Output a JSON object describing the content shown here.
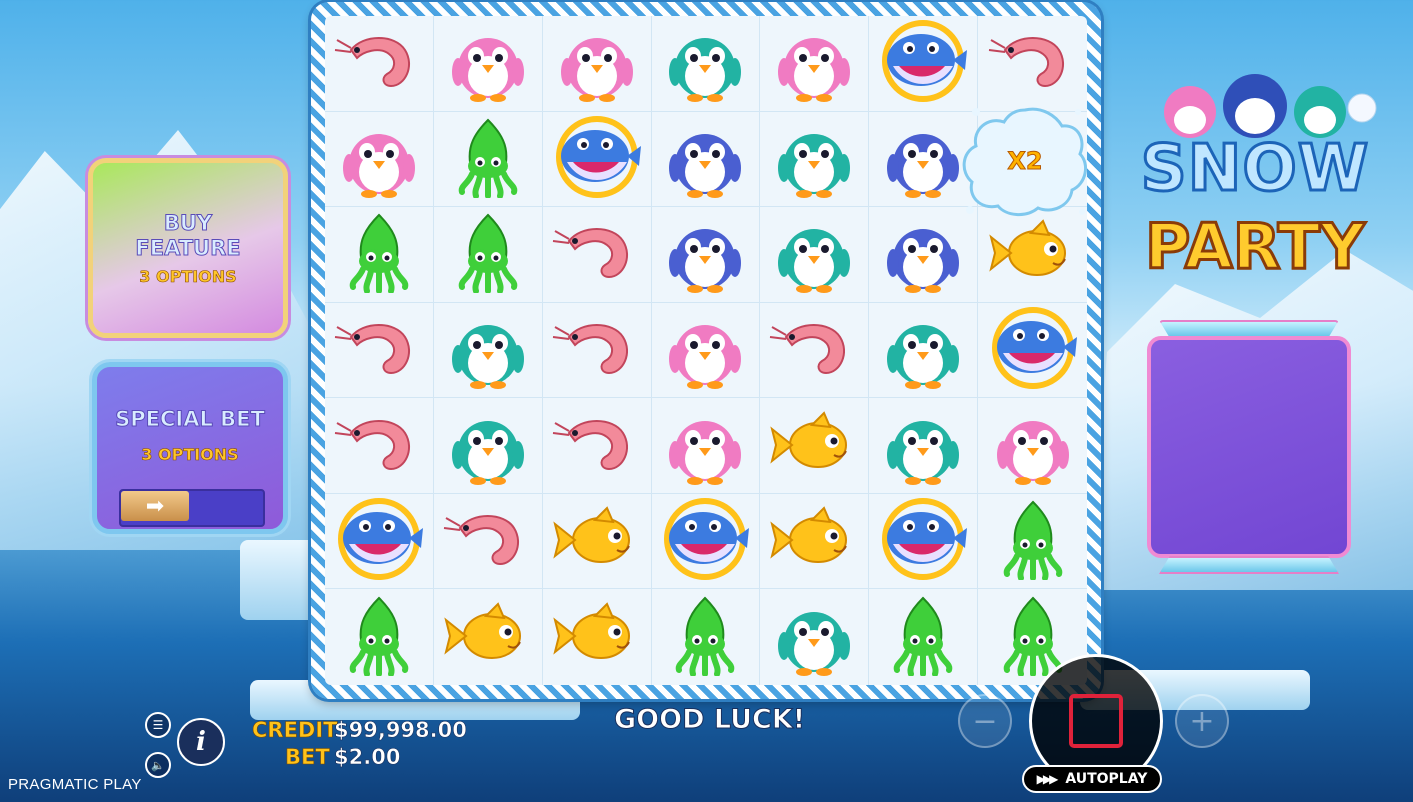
{
  "game": {
    "logo_line1": "SNOW",
    "logo_line2": "PARTY",
    "brand": "PRAGMATIC PLAY"
  },
  "buy_feature": {
    "title_line1": "BUY",
    "title_line2": "FEATURE",
    "subtitle": "3 OPTIONS"
  },
  "special_bet": {
    "title": "SPECIAL BET",
    "subtitle": "3 OPTIONS",
    "toggle_icon": "arrow-right-icon"
  },
  "multiplier": {
    "label": "X2"
  },
  "grid": {
    "columns": 7,
    "rows": [
      [
        "shrimp",
        "penguin-pink",
        "penguin-pink",
        "penguin-teal",
        "penguin-pink",
        "whale",
        "shrimp"
      ],
      [
        "penguin-pink",
        "squid",
        "whale",
        "penguin-blue",
        "penguin-teal",
        "penguin-blue",
        "multiplier-splash"
      ],
      [
        "squid",
        "squid",
        "shrimp",
        "penguin-blue",
        "penguin-teal",
        "penguin-blue",
        "fish"
      ],
      [
        "shrimp",
        "penguin-teal",
        "shrimp",
        "penguin-pink",
        "shrimp",
        "penguin-teal",
        "whale"
      ],
      [
        "shrimp",
        "penguin-teal",
        "shrimp",
        "penguin-pink",
        "fish",
        "penguin-teal",
        "penguin-pink"
      ],
      [
        "whale",
        "shrimp",
        "fish",
        "whale",
        "fish",
        "whale",
        "squid"
      ],
      [
        "squid",
        "fish",
        "fish",
        "squid",
        "penguin-teal",
        "squid",
        "squid"
      ]
    ]
  },
  "footer": {
    "credit_label": "CREDIT",
    "credit_value": "$99,998.00",
    "bet_label": "BET",
    "bet_value": "$2.00",
    "status": "GOOD LUCK!",
    "autoplay_label": "AUTOPLAY"
  },
  "colors": {
    "penguin-pink": "#f07bc2",
    "penguin-teal": "#22b3a3",
    "penguin-blue": "#4a5fd1",
    "shrimp": "#f28a9a",
    "squid": "#3fcf3a",
    "fish": "#ffc21a",
    "whale": "#3c7be0",
    "spin_accent": "#e0223a"
  }
}
